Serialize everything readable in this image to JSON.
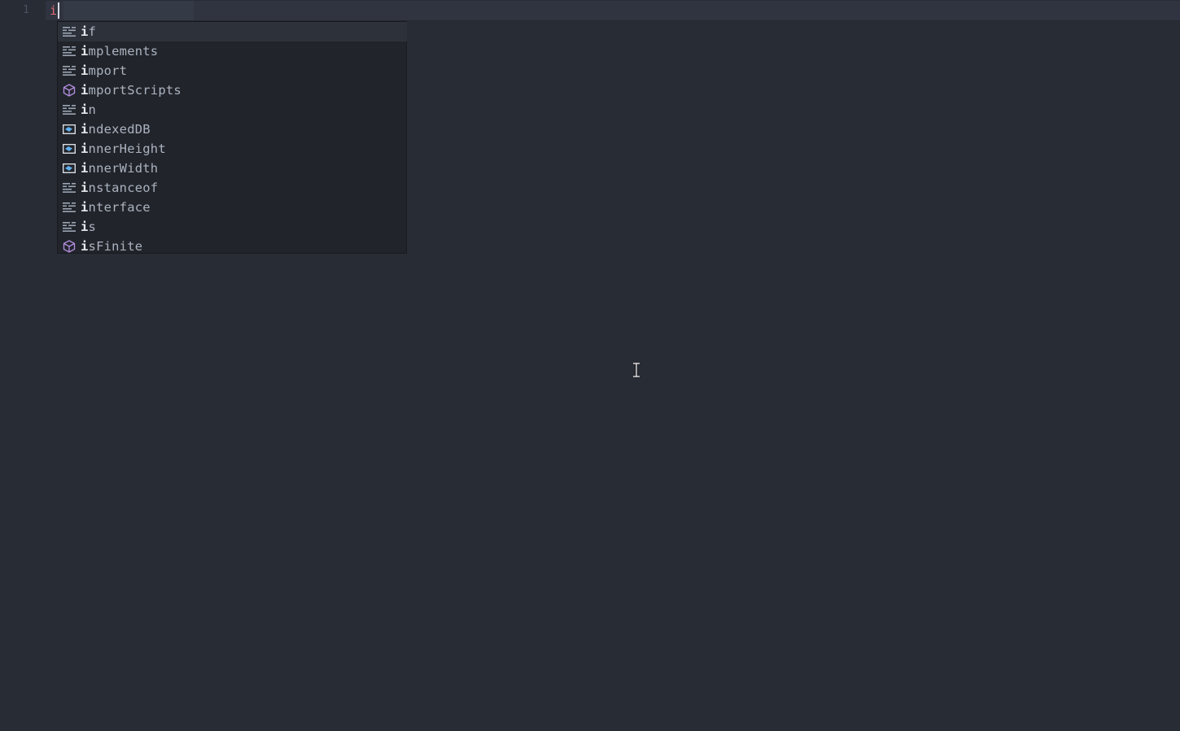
{
  "editor": {
    "line_number": "1",
    "typed_text": "i"
  },
  "autocomplete": {
    "selected_index": 0,
    "items": [
      {
        "match": "i",
        "rest": "f",
        "kind": "keyword-icon"
      },
      {
        "match": "i",
        "rest": "mplements",
        "kind": "keyword-icon"
      },
      {
        "match": "i",
        "rest": "mport",
        "kind": "keyword-icon"
      },
      {
        "match": "i",
        "rest": "mportScripts",
        "kind": "method-icon"
      },
      {
        "match": "i",
        "rest": "n",
        "kind": "keyword-icon"
      },
      {
        "match": "i",
        "rest": "ndexedDB",
        "kind": "property-icon"
      },
      {
        "match": "i",
        "rest": "nnerHeight",
        "kind": "property-icon"
      },
      {
        "match": "i",
        "rest": "nnerWidth",
        "kind": "property-icon"
      },
      {
        "match": "i",
        "rest": "nstanceof",
        "kind": "keyword-icon"
      },
      {
        "match": "i",
        "rest": "nterface",
        "kind": "keyword-icon"
      },
      {
        "match": "i",
        "rest": "s",
        "kind": "keyword-icon"
      },
      {
        "match": "i",
        "rest": "sFinite",
        "kind": "method-icon"
      }
    ]
  },
  "colors": {
    "background": "#282c34",
    "keyword_icon": "#9da5b4",
    "method_icon": "#b48ee0",
    "property_icon": "#61afef",
    "typed_text": "#e06c75"
  }
}
